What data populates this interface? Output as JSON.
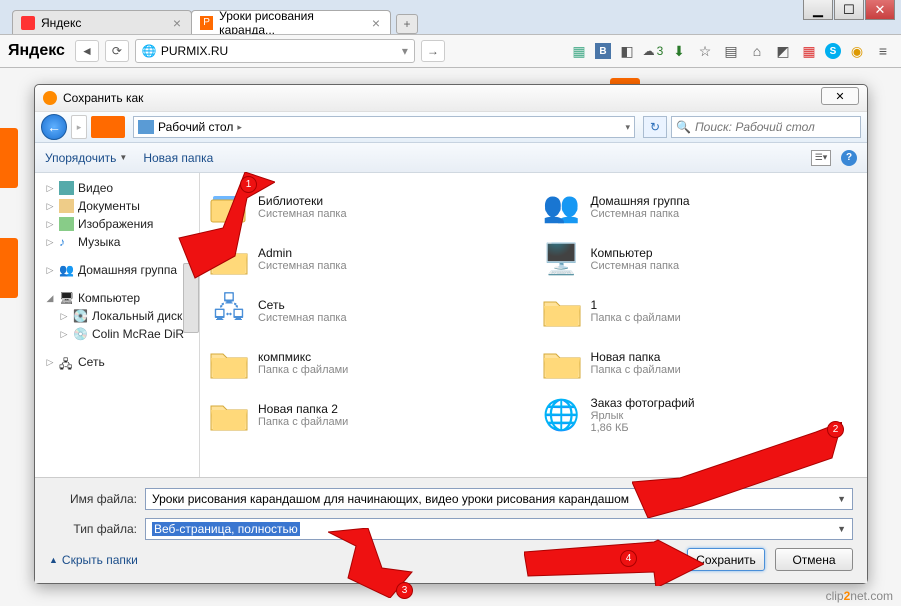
{
  "window_controls": {
    "min": "▁",
    "max": "☐",
    "close": "✕"
  },
  "tabs": [
    {
      "title": "Яндекс",
      "icon": "y"
    },
    {
      "title": "Уроки рисования каранда...",
      "icon": "p"
    }
  ],
  "addr": {
    "logo": "Яндекс",
    "url": "PURMIX.RU",
    "globe": "🌐",
    "lock": "🔒"
  },
  "toolbar_icons": {
    "weather": "☁",
    "weather_n": "3",
    "star": "☆",
    "menu": "≡"
  },
  "dialog": {
    "title": "Сохранить как",
    "close": "✕",
    "breadcrumb": "Рабочий стол",
    "bc_arrow": "▸",
    "search_placeholder": "Поиск: Рабочий стол",
    "organize": "Упорядочить",
    "new_folder": "Новая папка",
    "tree": {
      "items": [
        {
          "label": "Видео"
        },
        {
          "label": "Документы"
        },
        {
          "label": "Изображения"
        },
        {
          "label": "Музыка"
        }
      ],
      "homegroup": "Домашняя группа",
      "computer": "Компьютер",
      "drives": [
        {
          "label": "Локальный диск"
        },
        {
          "label": "Colin McRae DiR"
        }
      ],
      "network": "Сеть"
    },
    "files": [
      {
        "name": "Библиотеки",
        "sub": "Системная папка",
        "icon": "lib"
      },
      {
        "name": "Домашняя группа",
        "sub": "Системная папка",
        "icon": "homegroup"
      },
      {
        "name": "Admin",
        "sub": "Системная папка",
        "icon": "folder"
      },
      {
        "name": "Компьютер",
        "sub": "Системная папка",
        "icon": "computer"
      },
      {
        "name": "Сеть",
        "sub": "Системная папка",
        "icon": "network"
      },
      {
        "name": "1",
        "sub": "Папка с файлами",
        "icon": "folder"
      },
      {
        "name": "компмикс",
        "sub": "Папка с файлами",
        "icon": "folder"
      },
      {
        "name": "Новая папка",
        "sub": "Папка с файлами",
        "icon": "folder"
      },
      {
        "name": "Новая папка 2",
        "sub": "Папка с файлами",
        "icon": "folder"
      },
      {
        "name": "Заказ фотографий",
        "sub": "Ярлык",
        "sub2": "1,86 КБ",
        "icon": "globe"
      }
    ],
    "filename_label": "Имя файла:",
    "filename_value": "Уроки рисования карандашом для начинающих, видео уроки рисования карандашом",
    "filetype_label": "Тип файла:",
    "filetype_value": "Веб-страница, полностью",
    "hide_folders": "Скрыть папки",
    "save": "Сохранить",
    "cancel": "Отмена"
  },
  "annotations": {
    "1": "1",
    "2": "2",
    "3": "3",
    "4": "4"
  },
  "watermark": {
    "a": "clip",
    "b": "2",
    "c": "net",
    ".com": ".com"
  }
}
